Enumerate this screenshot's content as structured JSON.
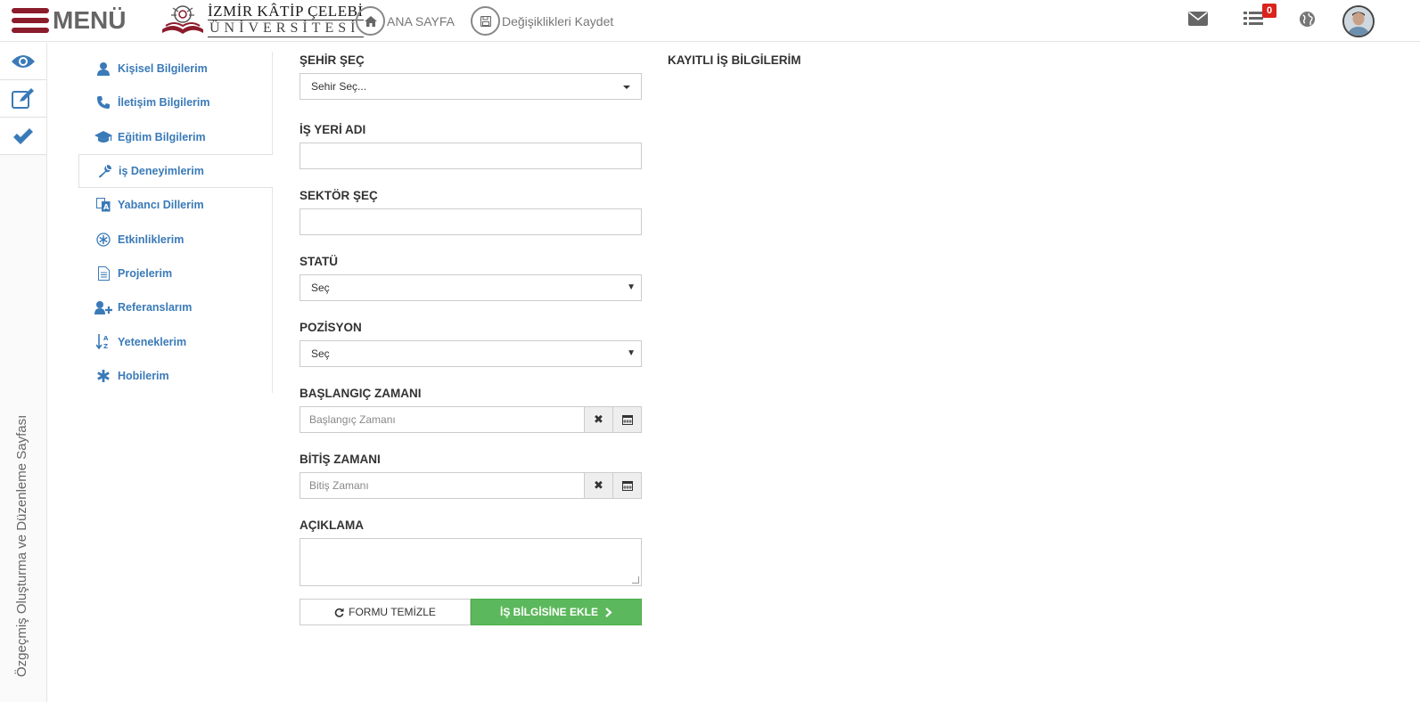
{
  "header": {
    "menu_label": "MENÜ",
    "logo_line1": "İZMİR KÂTİP ÇELEBİ",
    "logo_line2": "ÜNİVERSİTESİ",
    "home_label": "ANA SAYFA",
    "save_label": "Değişiklikleri Kaydet",
    "notification_count": "0"
  },
  "rail": {
    "vertical_text": "Özgeçmiş Oluşturma ve Düzenleme Sayfası"
  },
  "sidebar": {
    "items": [
      {
        "label": "Kişisel Bilgilerim",
        "icon": "user-icon"
      },
      {
        "label": "İletişim Bilgilerim",
        "icon": "phone-icon"
      },
      {
        "label": "Eğitim Bilgilerim",
        "icon": "graduation-cap-icon"
      },
      {
        "label": "iş Deneyimlerim",
        "icon": "wrench-icon",
        "active": true
      },
      {
        "label": "Yabancı Dillerim",
        "icon": "translate-icon"
      },
      {
        "label": "Etkinliklerim",
        "icon": "asterisk-circle-icon"
      },
      {
        "label": "Projelerim",
        "icon": "document-icon"
      },
      {
        "label": "Referanslarım",
        "icon": "user-add-icon"
      },
      {
        "label": "Yeteneklerim",
        "icon": "sort-alpha-icon"
      },
      {
        "label": "Hobilerim",
        "icon": "asterisk-icon"
      }
    ]
  },
  "form": {
    "city_label": "ŞEHİR ŞEÇ",
    "city_value": "Sehir Seç...",
    "workplace_label": "İŞ YERİ ADI",
    "workplace_value": "",
    "sector_label": "SEKTÖR ŞEÇ",
    "sector_value": "",
    "status_label": "STATÜ",
    "status_value": "Seç",
    "position_label": "POZİSYON",
    "position_value": "Seç",
    "start_label": "BAŞLANGIÇ ZAMANI",
    "start_placeholder": "Başlangıç Zamanı",
    "end_label": "BİTİŞ ZAMANI",
    "end_placeholder": "Bitiş Zamanı",
    "desc_label": "AÇIKLAMA",
    "clear_button": "FORMU TEMİZLE",
    "add_button": "İŞ BİLGİSİNE EKLE"
  },
  "saved": {
    "title": "KAYITLI İŞ BİLGİLERİM"
  },
  "colors": {
    "brand": "#8b1c2c",
    "link": "#3a7ab8",
    "success": "#5cb85c",
    "badge": "#d9241c"
  }
}
